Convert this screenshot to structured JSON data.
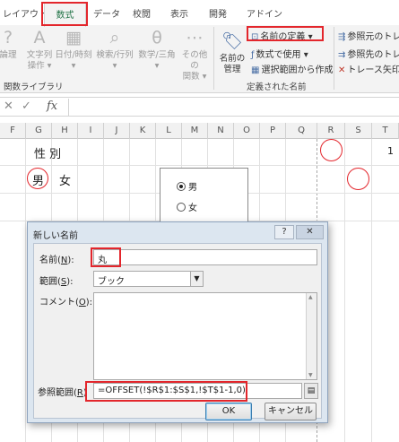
{
  "ribbon": {
    "tabs": [
      "レイアウト",
      "数式",
      "データ",
      "校閲",
      "表示",
      "開発",
      "アドイン"
    ],
    "active_tab": "数式",
    "library_buttons": [
      {
        "label1": "論理",
        "label2": ""
      },
      {
        "label1": "文字列",
        "label2": "操作 ▾"
      },
      {
        "label1": "日付/時刻",
        "label2": "▾"
      },
      {
        "label1": "検索/行列",
        "label2": "▾"
      },
      {
        "label1": "数学/三角",
        "label2": "▾"
      },
      {
        "label1": "その他の",
        "label2": "関数 ▾"
      }
    ],
    "library_group_label": "関数ライブラリ",
    "name_manager_label1": "名前の",
    "name_manager_label2": "管理",
    "define_name_label": "名前の定義 ▾",
    "use_in_formula_label": "数式で使用 ▾",
    "create_from_selection_label": "選択範囲から作成",
    "defined_names_group_label": "定義された名前",
    "trace_precedents_label": "参照元のトレ",
    "trace_dependents_label": "参照先のトレ",
    "remove_arrows_label": "トレース矢印"
  },
  "formula_bar": {
    "cancel_glyph": "✕",
    "enter_glyph": "✓",
    "fx_label": "fx"
  },
  "sheet": {
    "columns": [
      "F",
      "G",
      "H",
      "I",
      "J",
      "K",
      "L",
      "M",
      "N",
      "O",
      "P",
      "Q",
      "R",
      "S",
      "T"
    ],
    "header_text": "性 別",
    "male_text": "男",
    "female_text": "女",
    "t1_value": "1",
    "options": {
      "male": "男",
      "female": "女"
    }
  },
  "dialog": {
    "title": "新しい名前",
    "help_label": "?",
    "close_label": "✕",
    "name_label": "名前(",
    "name_key": "N",
    "name_suffix": "):",
    "name_value": "丸",
    "scope_label": "範囲(",
    "scope_key": "S",
    "scope_suffix": "):",
    "scope_value": "ブック",
    "comment_label": "コメント(",
    "comment_key": "O",
    "comment_suffix": "):",
    "refers_label": "参照範囲(",
    "refers_key": "R",
    "refers_suffix": ")",
    "refers_value": "=OFFSET(!$R$1:$S$1,!$T$1-1,0)",
    "ok_label": "OK",
    "cancel_label": "キャンセル"
  },
  "colors": {
    "highlight_red": "#e3262c",
    "excel_green": "#217346"
  }
}
